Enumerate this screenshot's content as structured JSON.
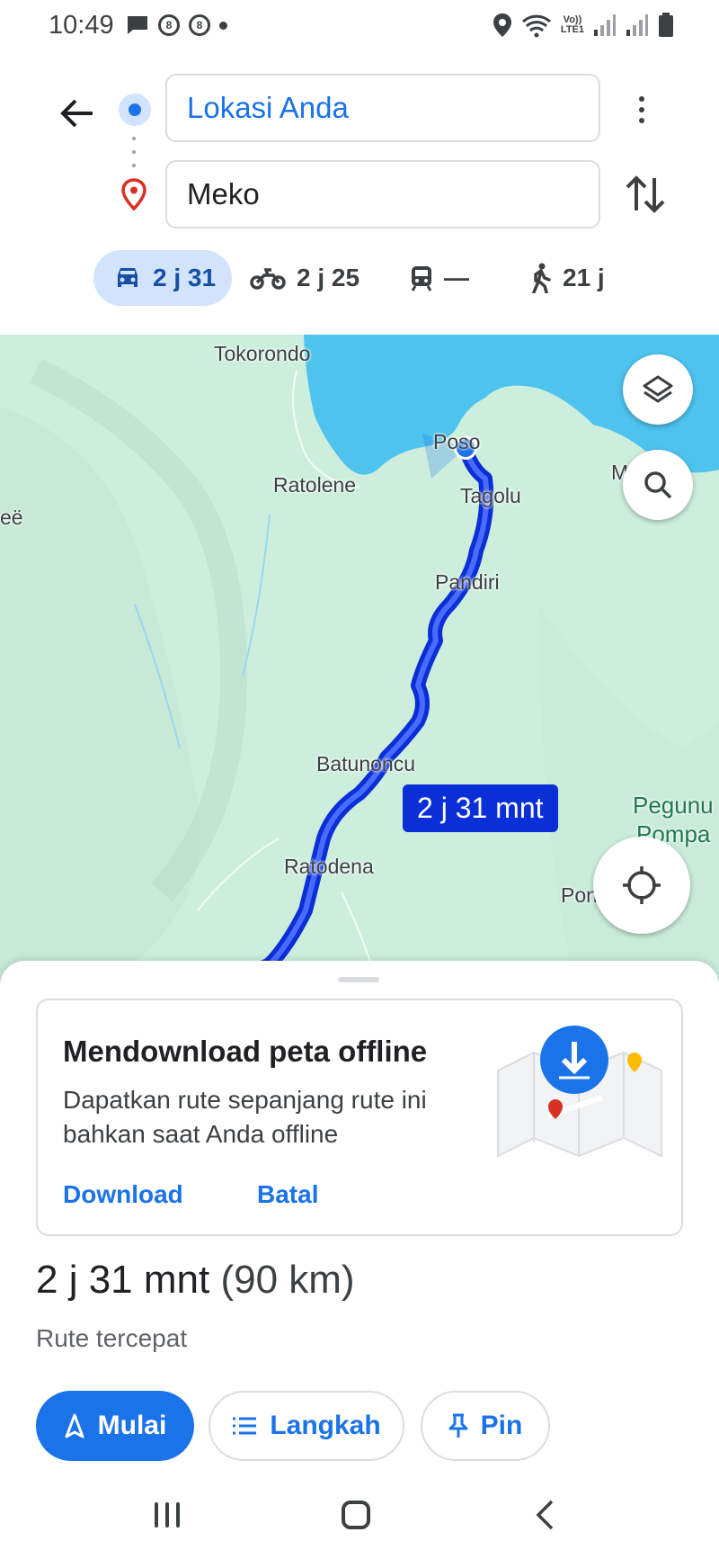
{
  "status_bar": {
    "time": "10:49",
    "left_icons": [
      "message-icon",
      "notification-icon",
      "notification-icon",
      "dot"
    ],
    "badge_text": "8",
    "lte_label_1": "Vo))",
    "lte_label_2": "LTE1",
    "right_icons": [
      "location-icon",
      "wifi-icon",
      "lte-icon",
      "signal-icon",
      "signal-icon",
      "battery-icon"
    ]
  },
  "directions": {
    "origin": "Lokasi Anda",
    "destination": "Meko",
    "modes": [
      {
        "name": "car",
        "label": "2 j 31",
        "active": true
      },
      {
        "name": "motorcycle",
        "label": "2 j 25",
        "active": false
      },
      {
        "name": "transit",
        "label": "—",
        "active": false
      },
      {
        "name": "walk",
        "label": "21 j",
        "active": false
      }
    ]
  },
  "map": {
    "places": [
      "Tokorondo",
      "Ratolene",
      "Poso",
      "Tagolu",
      "Pandiri",
      "Batunoncu",
      "Ratodena",
      "Pondo",
      "Pegunu",
      "Pompa",
      "eë",
      "M"
    ],
    "route_duration": "2 j 31 mnt",
    "colors": {
      "land": "#cdeedd",
      "water": "#4dc3ee",
      "route": "#0b2fd6",
      "accent": "#1a73e8"
    }
  },
  "offline_card": {
    "title": "Mendownload peta offline",
    "description": "Dapatkan rute sepanjang rute ini bahkan saat Anda offline",
    "download": "Download",
    "cancel": "Batal"
  },
  "summary": {
    "duration": "2 j 31 mnt",
    "distance": "(90 km)",
    "note": "Rute tercepat"
  },
  "actions": {
    "start": "Mulai",
    "steps": "Langkah",
    "pin": "Pin"
  }
}
